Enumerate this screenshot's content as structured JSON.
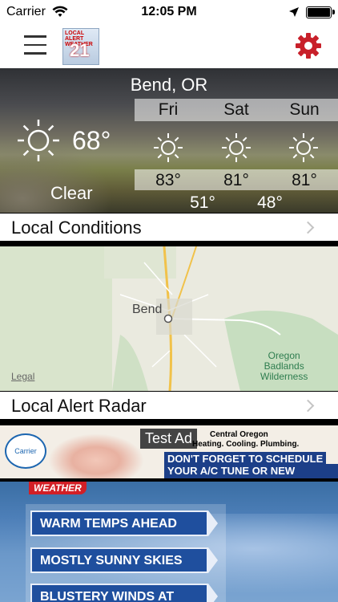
{
  "status_bar": {
    "carrier": "Carrier",
    "time": "12:05 PM"
  },
  "header": {
    "logo_text_top": "LOCAL ALERT WEATHER",
    "logo_number": "21"
  },
  "weather": {
    "city": "Bend, OR",
    "current_temp": "68°",
    "condition": "Clear",
    "forecast": [
      {
        "day": "Fri",
        "high": "83°",
        "low": "",
        "icon": "sun-icon"
      },
      {
        "day": "Sat",
        "high": "81°",
        "low": "51°",
        "icon": "sun-icon"
      },
      {
        "day": "Sun",
        "high": "81°",
        "low": "48°",
        "icon": "sun-icon"
      }
    ]
  },
  "sections": {
    "local_conditions": "Local Conditions",
    "radar": "Local Alert Radar"
  },
  "map": {
    "city_label": "Bend",
    "wilderness_label": [
      "Oregon",
      "Badlands",
      "Wilderness"
    ],
    "legal": "Legal"
  },
  "ad": {
    "badge": "Test Ad",
    "line1": "Central Oregon",
    "line2": "Heating. Cooling. Plumbing.",
    "line3": "DON'T FORGET TO SCHEDULE",
    "line4": "YOUR A/C TUNE OR NEW INSTALL",
    "brand": "Carrier"
  },
  "promo": {
    "logo": "WEATHER",
    "banners": [
      "WARM TEMPS AHEAD",
      "MOSTLY SUNNY SKIES",
      "BLUSTERY WINDS AT TIMES"
    ]
  },
  "colors": {
    "accent": "#c8202a",
    "nav_bg": "#ffffff",
    "banner_blue": "#1f4f9e"
  }
}
